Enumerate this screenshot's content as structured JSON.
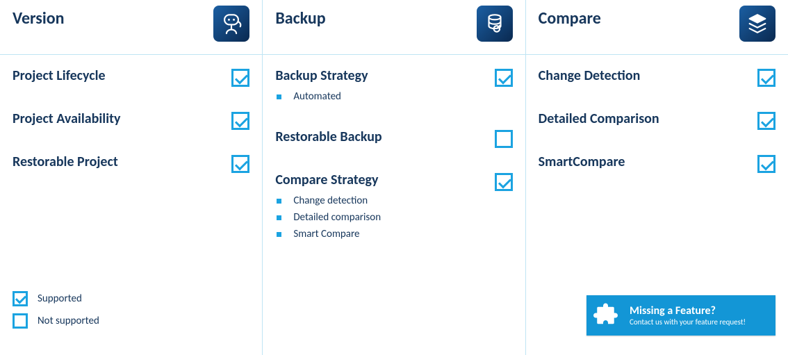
{
  "columns": [
    {
      "title": "Version",
      "icon": "robot-icon",
      "features": [
        {
          "title": "Project Lifecycle",
          "checked": true,
          "bullets": []
        },
        {
          "title": "Project Availability",
          "checked": true,
          "bullets": []
        },
        {
          "title": "Restorable Project",
          "checked": true,
          "bullets": []
        }
      ]
    },
    {
      "title": "Backup",
      "icon": "database-restore-icon",
      "features": [
        {
          "title": "Backup Strategy",
          "checked": true,
          "bullets": [
            "Automated"
          ]
        },
        {
          "title": "Restorable Backup",
          "checked": false,
          "bullets": []
        },
        {
          "title": "Compare Strategy",
          "checked": true,
          "bullets": [
            "Change detection",
            "Detailed comparison",
            "Smart Compare"
          ]
        }
      ]
    },
    {
      "title": "Compare",
      "icon": "layers-icon",
      "features": [
        {
          "title": "Change Detection",
          "checked": true,
          "bullets": []
        },
        {
          "title": "Detailed Comparison",
          "checked": true,
          "bullets": []
        },
        {
          "title": "SmartCompare",
          "checked": true,
          "bullets": []
        }
      ]
    }
  ],
  "legend": {
    "supported": "Supported",
    "not_supported": "Not supported"
  },
  "cta": {
    "title": "Missing a Feature?",
    "subtitle": "Contact us with your feature request!"
  },
  "colors": {
    "brand_dark": "#16365b",
    "accent": "#1ba3e1",
    "divider": "#bfe5f4",
    "cta_bg": "#1396d6"
  }
}
